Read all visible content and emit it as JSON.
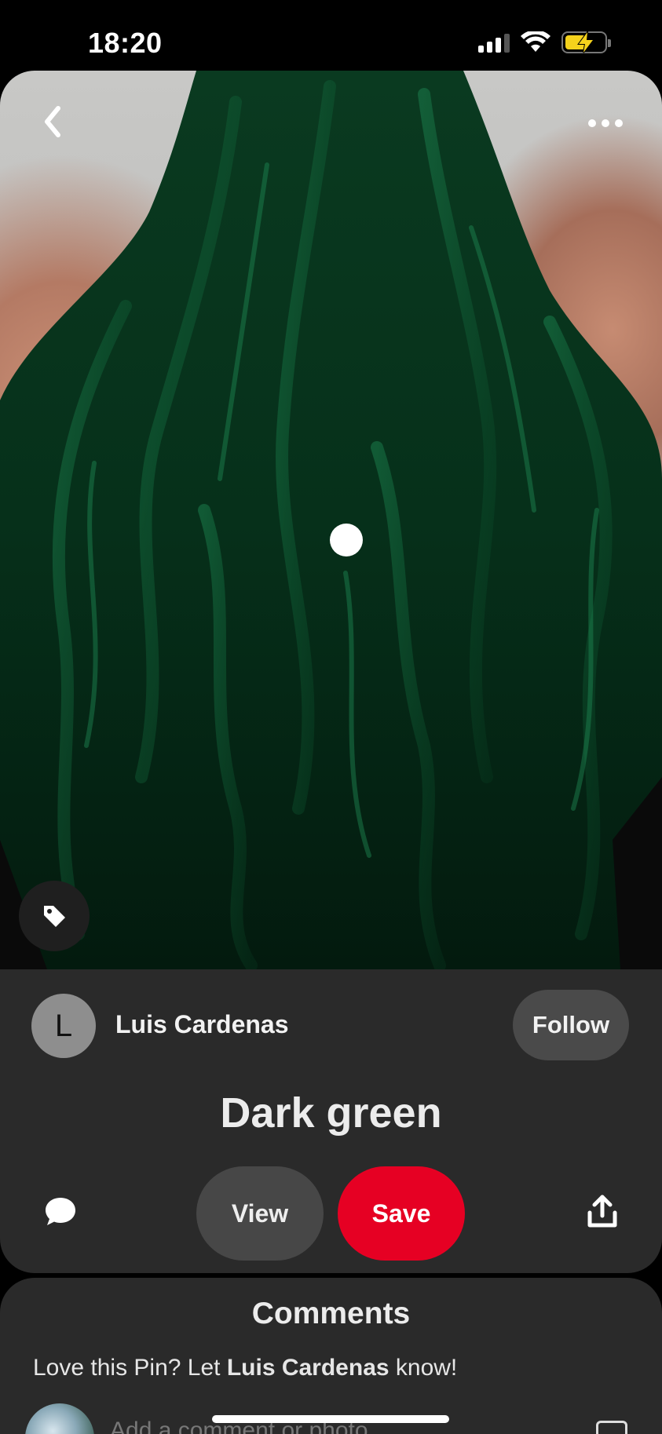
{
  "status_bar": {
    "time": "18:20"
  },
  "pin": {
    "title": "Dark green",
    "author": {
      "name": "Luis Cardenas",
      "initial": "L"
    },
    "follow_label": "Follow",
    "view_label": "View",
    "save_label": "Save"
  },
  "comments": {
    "title": "Comments",
    "prompt_prefix": "Love this Pin? Let ",
    "prompt_name": "Luis Cardenas",
    "prompt_suffix": " know!",
    "input_placeholder": "Add a comment or photo"
  },
  "colors": {
    "save_red": "#e60023",
    "sheet_bg": "#2a2a2a",
    "hair_green": "#0b3d24"
  },
  "icons": {
    "back": "chevron-left-icon",
    "more": "more-horizontal-icon",
    "tag": "tag-icon",
    "comment": "speech-bubble-icon",
    "share": "share-upload-icon",
    "add_photo": "image-icon"
  }
}
